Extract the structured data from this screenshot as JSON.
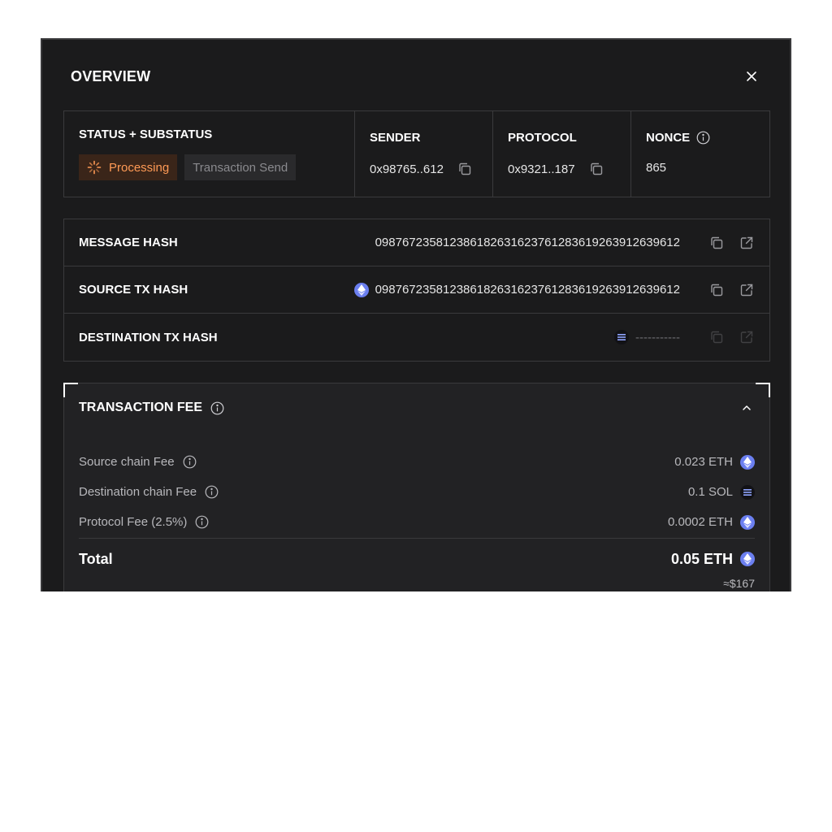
{
  "modal": {
    "title": "OVERVIEW"
  },
  "info": {
    "status_label": "STATUS + SUBSTATUS",
    "status": "Processing",
    "substatus": "Transaction Send",
    "sender_label": "SENDER",
    "sender": "0x98765..612",
    "protocol_label": "PROTOCOL",
    "protocol": "0x9321..187",
    "nonce_label": "NONCE",
    "nonce": "865"
  },
  "hashes": [
    {
      "label": "MESSAGE HASH",
      "value": "0987672358123861826316237612836192639126396 12",
      "chain": ""
    },
    {
      "label": "SOURCE TX HASH",
      "value": "098767235812386182631623761283619263912639612",
      "chain": "eth-icon"
    },
    {
      "label": "DESTINATION TX HASH",
      "value": "-----------",
      "chain": "sol-icon"
    }
  ],
  "fee": {
    "title": "TRANSACTION FEE",
    "rows": [
      {
        "label": "Source chain Fee",
        "value": "0.023 ETH",
        "token": "eth-icon"
      },
      {
        "label": "Destination chain Fee",
        "value": "0.1 SOL",
        "token": "sol-icon"
      },
      {
        "label": "Protocol Fee (2.5%)",
        "value": "0.0002 ETH",
        "token": "eth-icon"
      }
    ],
    "total_label": "Total",
    "total_value": "0.05 ETH",
    "total_usd": "≈$167"
  },
  "colors": {
    "accent_processing": "#ff9a55",
    "eth": "#6b7ff0",
    "background": "#1b1b1c"
  }
}
